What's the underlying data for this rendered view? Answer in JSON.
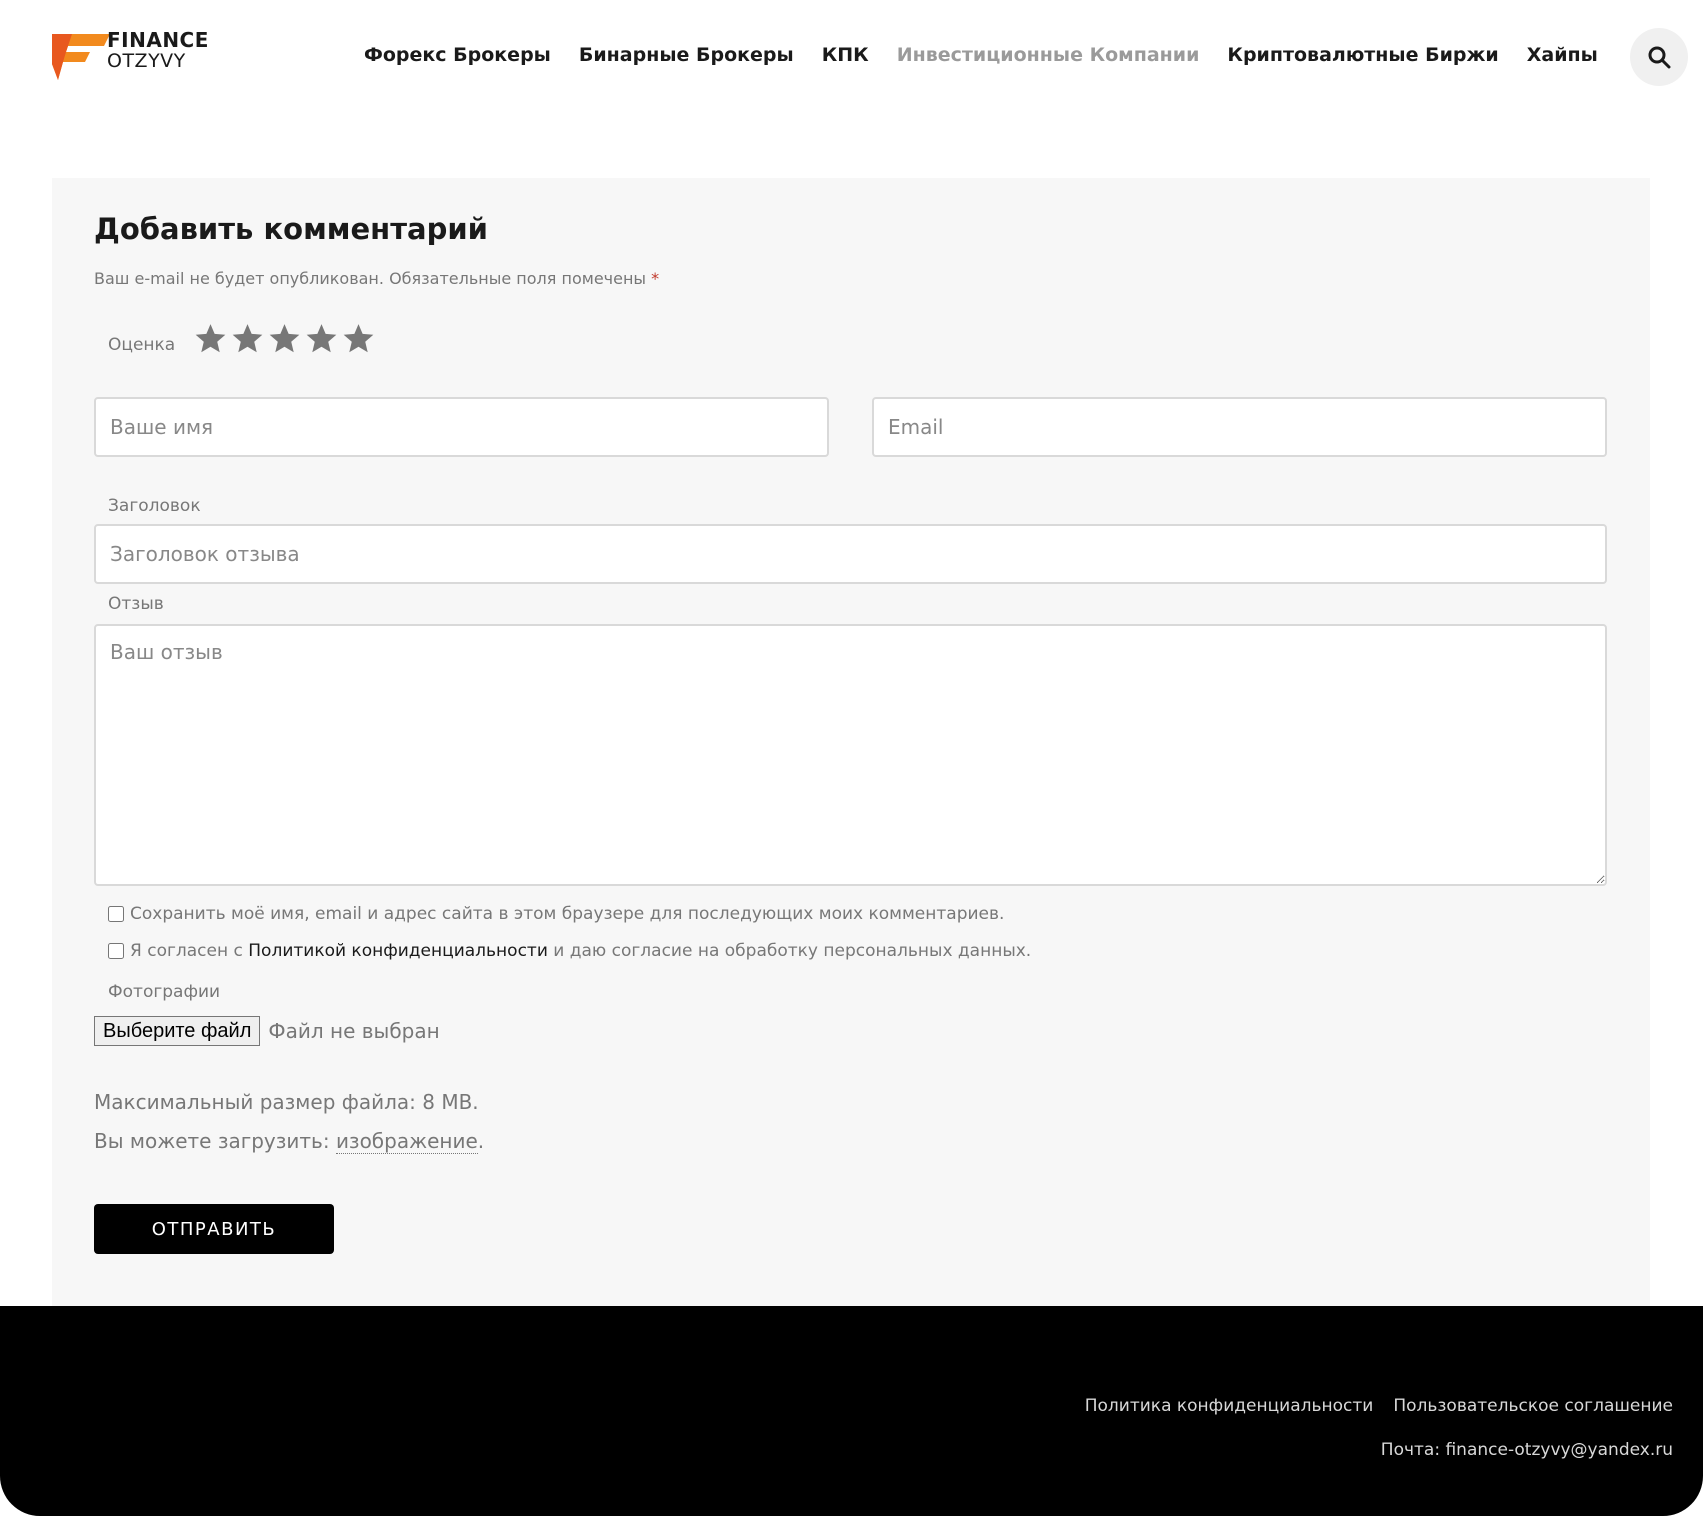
{
  "logo": {
    "line1": "FINANCE",
    "line2": "OTZYVY",
    "colors": {
      "orange": "#f28a1e",
      "red": "#e8581f"
    }
  },
  "nav": {
    "items": [
      {
        "label": "Форекс Брокеры"
      },
      {
        "label": "Бинарные Брокеры"
      },
      {
        "label": "КПК"
      },
      {
        "label": "Инвестиционные Компании"
      },
      {
        "label": "Криптовалютные Биржи"
      },
      {
        "label": "Хайпы"
      }
    ],
    "search_icon": "search-icon"
  },
  "form": {
    "title": "Добавить комментарий",
    "notice": "Ваш e-mail не будет опубликован. Обязательные поля помечены",
    "required_mark": "*",
    "rating_label": "Оценка",
    "rating_stars": 5,
    "name_placeholder": "Ваше имя",
    "email_placeholder": "Email",
    "title_label": "Заголовок",
    "title_placeholder": "Заголовок отзыва",
    "review_label": "Отзыв",
    "review_placeholder": "Ваш отзыв",
    "save_checkbox": "Сохранить моё имя, email и адрес сайта в этом браузере для последующих моих комментариев.",
    "agree_prefix": "Я согласен с",
    "agree_link": "Политикой конфиденциальности",
    "agree_suffix": "и даю согласие на обработку персональных данных.",
    "photos_label": "Фотографии",
    "file_button": "Выберите файл",
    "file_status": "Файл не выбран",
    "max_size": "Максимальный размер файла: 8 MB.",
    "upload_prefix": "Вы можете загрузить:",
    "upload_type": "изображение",
    "upload_suffix": ".",
    "submit": "ОТПРАВИТЬ"
  },
  "footer": {
    "privacy": "Политика конфиденциальности",
    "terms": "Пользовательское соглашение",
    "mail": "Почта: finance-otzyvy@yandex.ru"
  }
}
